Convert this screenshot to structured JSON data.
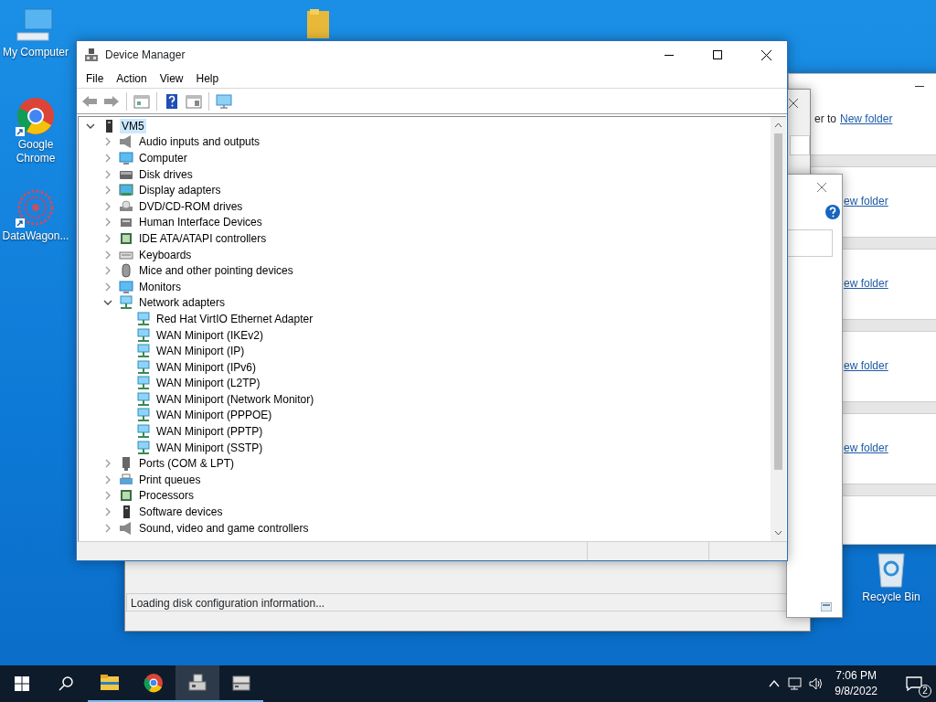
{
  "desktop_icons": [
    {
      "label": "My Computer"
    },
    {
      "label": "Google Chrome"
    },
    {
      "label": "DataWagon..."
    },
    {
      "label": "Recycle Bin"
    }
  ],
  "explorer_window": {
    "lines": [
      {
        "text": "er to",
        "link": "New folder"
      },
      {
        "link": "ew folder"
      },
      {
        "link": "ew folder"
      },
      {
        "link": "ew folder"
      },
      {
        "link": "ew folder"
      }
    ]
  },
  "disk_management": {
    "status": "Loading disk configuration information..."
  },
  "device_manager": {
    "title": "Device Manager",
    "menu": [
      "File",
      "Action",
      "View",
      "Help"
    ],
    "tree": {
      "label": "VM5",
      "expanded": true,
      "selected": true,
      "children": [
        {
          "label": "Audio inputs and outputs",
          "expanded": false,
          "selected": false
        },
        {
          "label": "Computer",
          "expanded": false,
          "selected": false
        },
        {
          "label": "Disk drives",
          "expanded": false,
          "selected": false
        },
        {
          "label": "Display adapters",
          "expanded": false,
          "selected": false
        },
        {
          "label": "DVD/CD-ROM drives",
          "expanded": false,
          "selected": false
        },
        {
          "label": "Human Interface Devices",
          "expanded": false,
          "selected": false
        },
        {
          "label": "IDE ATA/ATAPI controllers",
          "expanded": false,
          "selected": false
        },
        {
          "label": "Keyboards",
          "expanded": false,
          "selected": false
        },
        {
          "label": "Mice and other pointing devices",
          "expanded": false,
          "selected": false
        },
        {
          "label": "Monitors",
          "expanded": false,
          "selected": false
        },
        {
          "label": "Network adapters",
          "expanded": true,
          "selected": false,
          "children": [
            {
              "label": "Red Hat VirtIO Ethernet Adapter",
              "selected": false
            },
            {
              "label": "WAN Miniport (IKEv2)",
              "selected": false
            },
            {
              "label": "WAN Miniport (IP)",
              "selected": false
            },
            {
              "label": "WAN Miniport (IPv6)",
              "selected": false
            },
            {
              "label": "WAN Miniport (L2TP)",
              "selected": false
            },
            {
              "label": "WAN Miniport (Network Monitor)",
              "selected": false
            },
            {
              "label": "WAN Miniport (PPPOE)",
              "selected": false
            },
            {
              "label": "WAN Miniport (PPTP)",
              "selected": false
            },
            {
              "label": "WAN Miniport (SSTP)",
              "selected": false
            }
          ]
        },
        {
          "label": "Ports (COM & LPT)",
          "expanded": false,
          "selected": false
        },
        {
          "label": "Print queues",
          "expanded": false,
          "selected": false
        },
        {
          "label": "Processors",
          "expanded": false,
          "selected": false
        },
        {
          "label": "Software devices",
          "expanded": false,
          "selected": false
        },
        {
          "label": "Sound, video and game controllers",
          "expanded": false,
          "selected": false
        }
      ]
    }
  },
  "taskbar": {
    "apps": [
      {
        "selected": false
      },
      {
        "selected": false
      },
      {
        "selected": true
      },
      {
        "selected": false
      }
    ],
    "time": "7:06 PM",
    "date": "9/8/2022",
    "notification_count": "2"
  }
}
